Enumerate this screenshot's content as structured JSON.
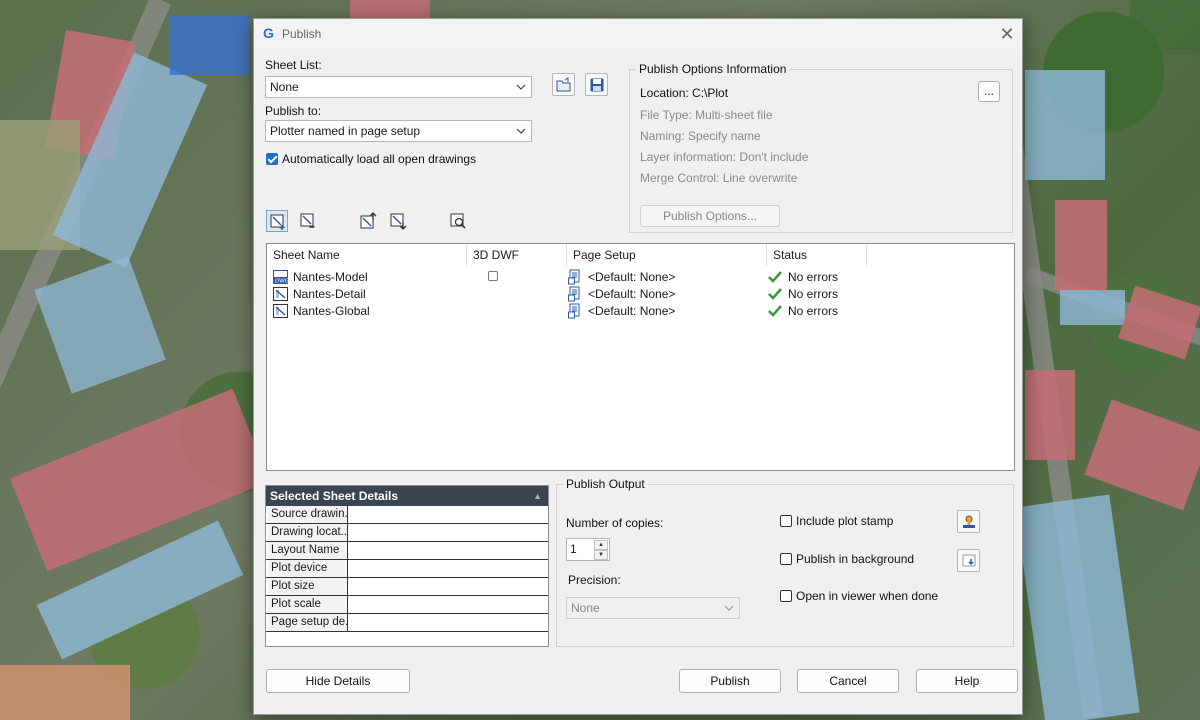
{
  "window": {
    "title": "Publish",
    "close_glyph": "✕",
    "app_icon": "G"
  },
  "sheet_list": {
    "label": "Sheet List:",
    "value": "None"
  },
  "publish_to": {
    "label": "Publish to:",
    "value": "Plotter named in page setup"
  },
  "auto_load": {
    "label": "Automatically load all open drawings",
    "checked": true
  },
  "options_info": {
    "title": "Publish Options Information",
    "location_label": "Location:",
    "location_value": "C:\\Plot",
    "browse_label": "...",
    "file_type": "File Type:   Multi-sheet file",
    "naming": "Naming:  Specify name",
    "layer_info": "Layer information:   Don't include",
    "merge_control": "Merge Control:   Line overwrite",
    "options_button": "Publish Options..."
  },
  "sheet_table": {
    "columns": [
      "Sheet Name",
      "3D DWF",
      "Page Setup",
      "Status"
    ],
    "rows": [
      {
        "name": "Nantes-Model",
        "page_setup": "<Default: None>",
        "status": "No errors"
      },
      {
        "name": "Nantes-Detail",
        "page_setup": "<Default: None>",
        "status": "No errors"
      },
      {
        "name": "Nantes-Global",
        "page_setup": "<Default: None>",
        "status": "No errors"
      }
    ]
  },
  "details": {
    "title": "Selected Sheet Details",
    "rows": [
      "Source drawin...",
      "Drawing locat...",
      "Layout Name",
      "Plot device",
      "Plot size",
      "Plot scale",
      "Page setup de..."
    ]
  },
  "publish_output": {
    "title": "Publish Output",
    "copies_label": "Number of copies:",
    "copies_value": "1",
    "precision_label": "Precision:",
    "precision_value": "None",
    "include_stamp": "Include plot stamp",
    "background": "Publish in background",
    "open_viewer": "Open in viewer when done"
  },
  "buttons": {
    "hide_details": "Hide Details",
    "publish": "Publish",
    "cancel": "Cancel",
    "help": "Help"
  },
  "colors": {
    "accent": "#1f6fc9",
    "header_dark": "#3b4550",
    "ok_green": "#3a9a3a"
  }
}
